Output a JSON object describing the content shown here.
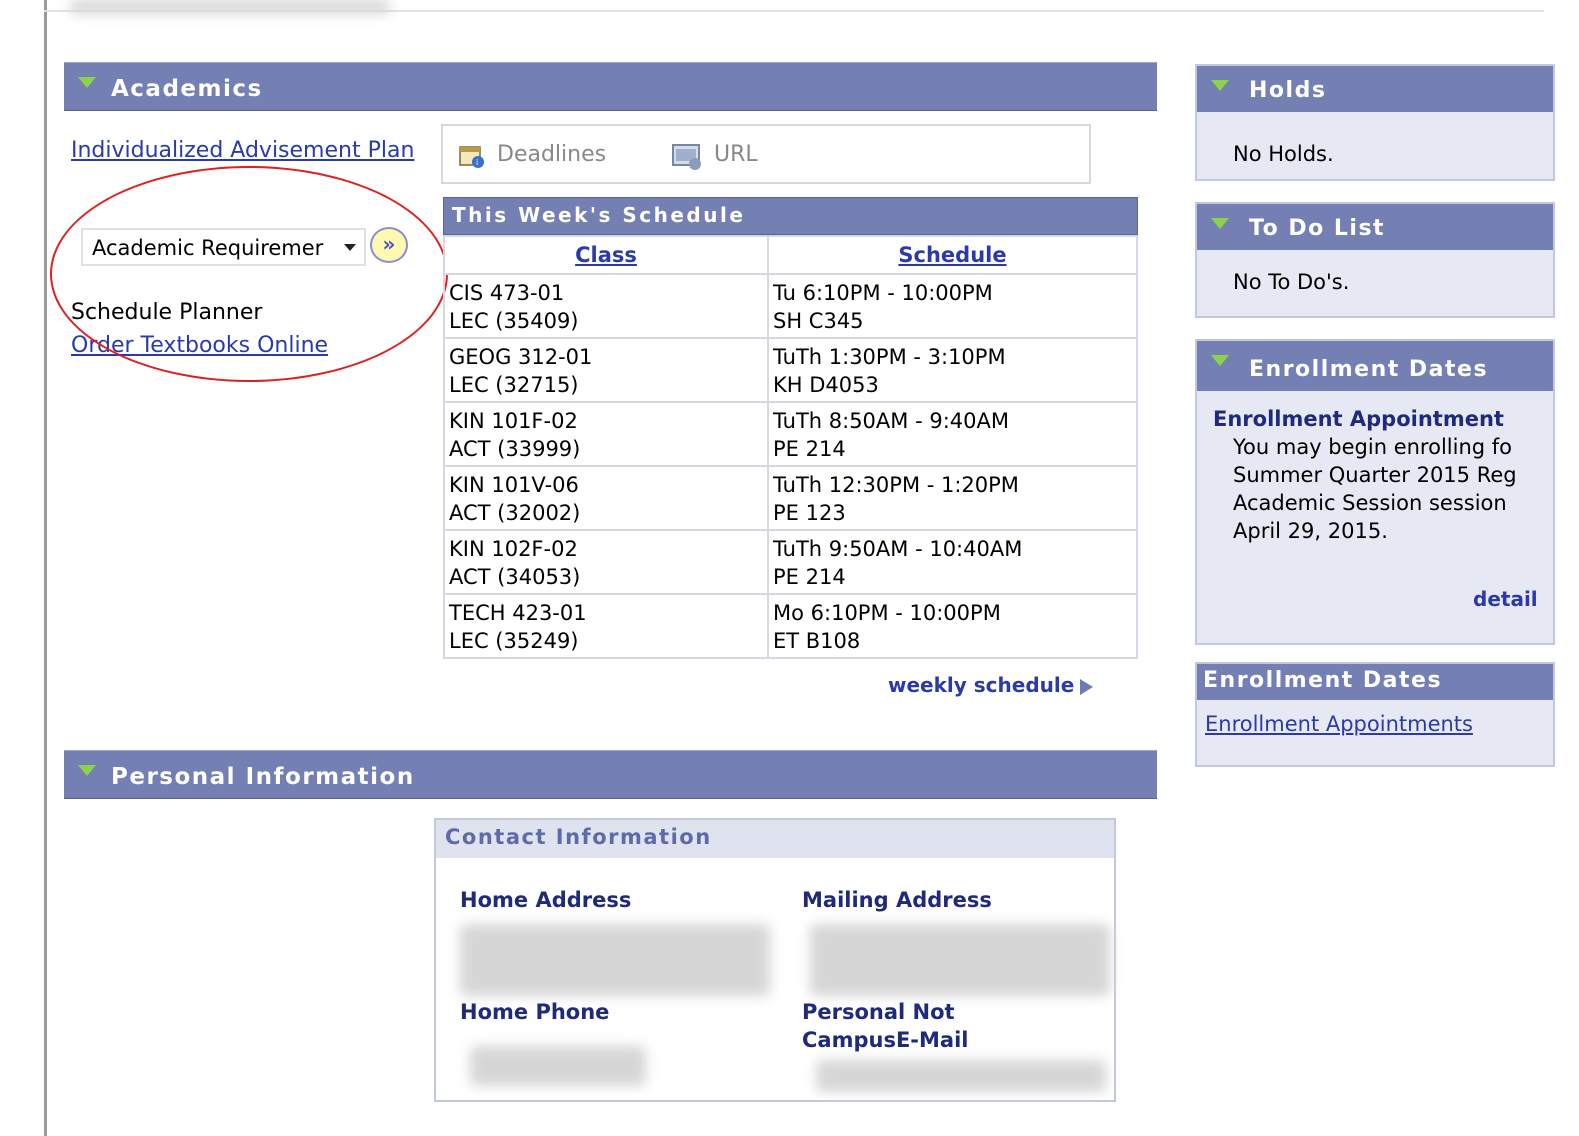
{
  "academics": {
    "title": "Academics",
    "advisement_link": "Individualized Advisement Plan",
    "dropdown_value": "Academic Requiremer",
    "go_button": "»",
    "schedule_planner": "Schedule Planner",
    "order_textbooks": "Order Textbooks Online",
    "toolbar": {
      "deadlines": "Deadlines",
      "url": "URL"
    },
    "schedule": {
      "title": "This Week's Schedule",
      "columns": [
        "Class",
        "Schedule"
      ],
      "rows": [
        {
          "class1": "CIS 473-01",
          "class2": "LEC (35409)",
          "time": "Tu 6:10PM - 10:00PM",
          "room": "SH C345"
        },
        {
          "class1": "GEOG 312-01",
          "class2": "LEC (32715)",
          "time": "TuTh 1:30PM - 3:10PM",
          "room": "KH D4053"
        },
        {
          "class1": "KIN 101F-02",
          "class2": "ACT (33999)",
          "time": "TuTh 8:50AM - 9:40AM",
          "room": "PE 214"
        },
        {
          "class1": "KIN 101V-06",
          "class2": "ACT (32002)",
          "time": "TuTh 12:30PM - 1:20PM",
          "room": "PE 123"
        },
        {
          "class1": "KIN 102F-02",
          "class2": "ACT (34053)",
          "time": "TuTh 9:50AM - 10:40AM",
          "room": "PE 214"
        },
        {
          "class1": "TECH 423-01",
          "class2": "LEC (35249)",
          "time": "Mo 6:10PM - 10:00PM",
          "room": "ET B108"
        }
      ],
      "weekly_link": "weekly schedule"
    }
  },
  "personal": {
    "title": "Personal Information",
    "contact_title": "Contact Information",
    "home_address": "Home Address",
    "mailing_address": "Mailing Address",
    "home_phone": "Home Phone",
    "personal_email_line1": "Personal Not",
    "personal_email_line2": "CampusE-Mail"
  },
  "sidebar": {
    "holds": {
      "title": "Holds",
      "text": "No Holds."
    },
    "todo": {
      "title": "To Do List",
      "text": "No To Do's."
    },
    "enrollment_dates": {
      "title": "Enrollment Dates",
      "appointment_title": "Enrollment Appointment",
      "lines": [
        "You may begin enrolling fo",
        "Summer Quarter 2015 Reg",
        "Academic Session session",
        "April 29, 2015."
      ],
      "details": "detail"
    },
    "enrollment_dates2": {
      "title": "Enrollment Dates",
      "link": "Enrollment Appointments"
    }
  },
  "colors": {
    "header_bg": "#7480b3",
    "link": "#2a3aa8",
    "annotation": "#e02020",
    "triangle": "#8cd24a"
  }
}
